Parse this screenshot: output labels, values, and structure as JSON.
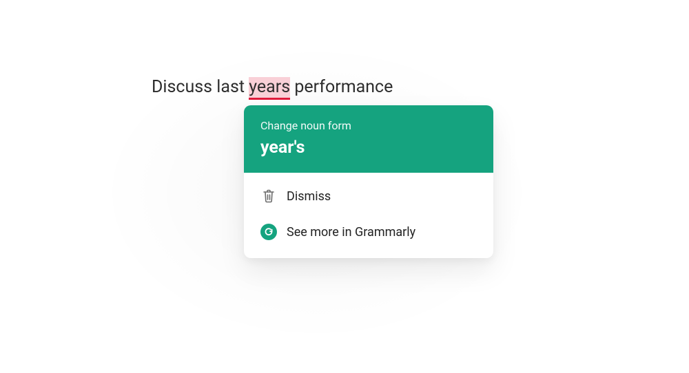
{
  "sentence": {
    "before": "Discuss last ",
    "highlight": "years",
    "after": " performance"
  },
  "popup": {
    "header_label": "Change noun form",
    "suggestion": "year's",
    "dismiss_label": "Dismiss",
    "see_more_label": "See more in Grammarly"
  },
  "colors": {
    "accent": "#15a37f",
    "error_underline": "#e11b3c",
    "error_bg": "#f9d0d7"
  }
}
